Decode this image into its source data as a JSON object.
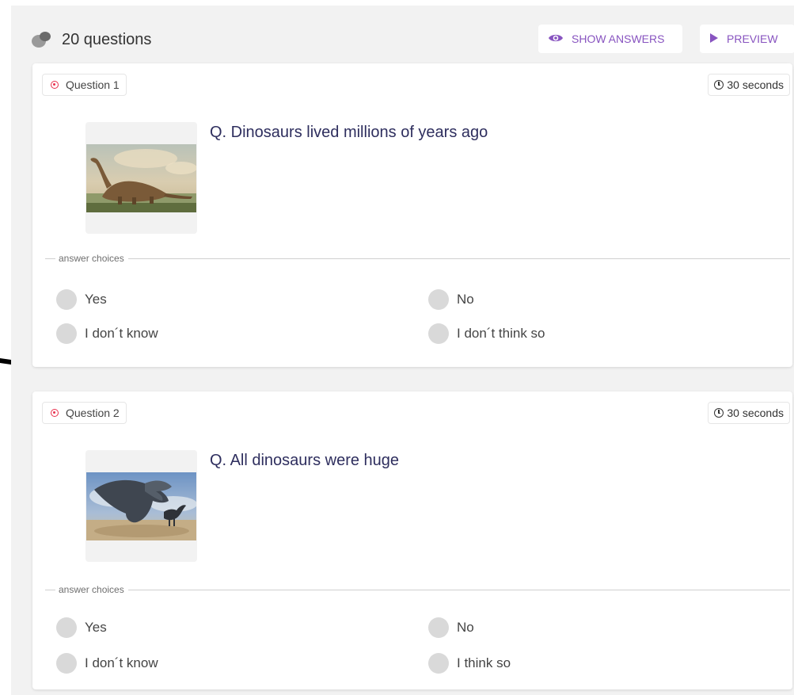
{
  "header": {
    "question_count": "20 questions",
    "show_answers_label": "SHOW ANSWERS",
    "preview_label": "PREVIEW"
  },
  "colors": {
    "accent": "#8854c0",
    "badge_icon": "#e8304d",
    "question_text": "#2e2e5e",
    "radio": "#d9d9d9"
  },
  "questions": [
    {
      "label": "Question 1",
      "time": "30 seconds",
      "text": "Q. Dinosaurs lived millions of years ago",
      "image_icon": "dinosaur-illustration-brachiosaurus",
      "divider_label": "answer choices",
      "choices": [
        "Yes",
        "No",
        "I don´t know",
        "I don´t think so"
      ]
    },
    {
      "label": "Question 2",
      "time": "30 seconds",
      "text": "Q. All dinosaurs were huge",
      "image_icon": "dinosaur-illustration-trex",
      "divider_label": "answer choices",
      "choices": [
        "Yes",
        "No",
        "I don´t know",
        "I think so"
      ]
    }
  ]
}
